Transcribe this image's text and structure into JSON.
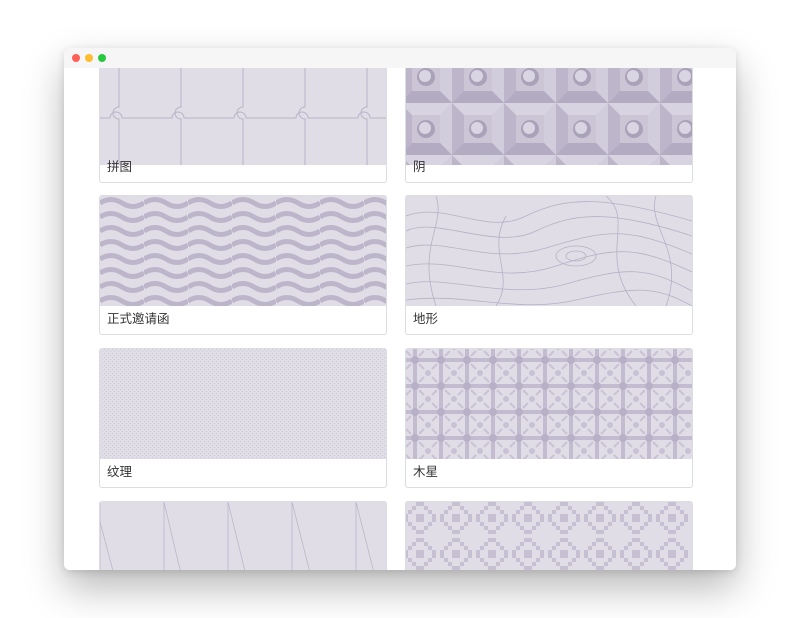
{
  "window": {
    "traffic_lights": [
      {
        "name": "close",
        "color": "#fe5f57"
      },
      {
        "name": "minimize",
        "color": "#febc2e"
      },
      {
        "name": "zoom",
        "color": "#28c840"
      }
    ]
  },
  "colors": {
    "pattern_background": "#e0dde7",
    "pattern_ink": "#c6c0d2",
    "card_border": "#dcdce3"
  },
  "patterns": [
    {
      "label": "拼图",
      "icon": "jigsaw-pattern"
    },
    {
      "label": "阴",
      "icon": "bevel-squares-pattern"
    },
    {
      "label": "正式邀请函",
      "icon": "wave-stripes-pattern"
    },
    {
      "label": "地形",
      "icon": "topography-pattern"
    },
    {
      "label": "纹理",
      "icon": "fine-texture-pattern"
    },
    {
      "label": "木星",
      "icon": "jupiter-lattice-pattern"
    },
    {
      "label": "",
      "icon": "diagonal-lines-pattern"
    },
    {
      "label": "",
      "icon": "pixel-diamond-pattern"
    }
  ]
}
